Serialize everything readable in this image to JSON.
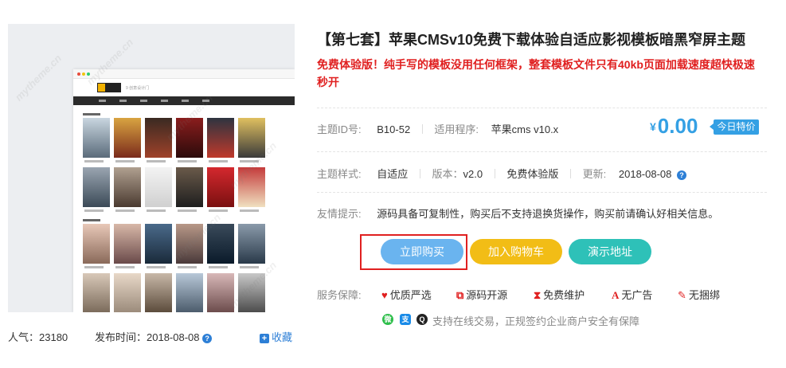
{
  "product": {
    "title": "【第七套】苹果CMSv10免费下载体验自适应影视模板暗黑窄屏主题",
    "description": "免费体验版！纯手写的模板没用任何框架，整套模板文件只有40kb页面加载速度超快极速秒开"
  },
  "preview": {
    "site_search_text": "9 创意设计门",
    "watermark_text": "mytheme.cn",
    "popularity_label": "人气：",
    "popularity_value": "23180",
    "publish_label": "发布时间：",
    "publish_date": "2018-08-08",
    "help_glyph": "?",
    "favorite_label": "收藏",
    "favorite_glyph": "+"
  },
  "info": {
    "theme_id_label": "主题ID号:",
    "theme_id_value": "B10-52",
    "program_label": "适用程序:",
    "program_value": "苹果cms v10.x",
    "style_label": "主题样式:",
    "style_value": "自适应",
    "version_label": "版本：",
    "version_value": "v2.0",
    "edition_value": "免费体验版",
    "update_label": "更新:",
    "update_value": "2018-08-08",
    "tip_label": "友情提示:",
    "tip_value": "源码具备可复制性，购买后不支持退换货操作，购买前请确认好相关信息。"
  },
  "price": {
    "currency": "¥",
    "amount": "0.00",
    "badge": "今日特价"
  },
  "buttons": {
    "buy": "立即购买",
    "cart": "加入购物车",
    "demo": "演示地址"
  },
  "service": {
    "label": "服务保障:",
    "items": [
      {
        "icon": "location-pin-icon",
        "glyph": "♥",
        "text": "优质严选"
      },
      {
        "icon": "copy-icon",
        "glyph": "⧉",
        "text": "源码开源"
      },
      {
        "icon": "hourglass-icon",
        "glyph": "⧗",
        "text": "免费维护"
      },
      {
        "icon": "font-icon",
        "glyph": "A",
        "text": "无广告"
      },
      {
        "icon": "wrench-icon",
        "glyph": "✎",
        "text": "无捆绑"
      }
    ]
  },
  "payment": {
    "wechat_glyph": "微",
    "alipay_glyph": "支",
    "qq_glyph": "Q",
    "text": "支持在线交易，正规签约企业商户安全有保障"
  },
  "colors": {
    "accent_blue": "#34a0e4",
    "highlight_red": "#e02020",
    "cart_yellow": "#f2bd16",
    "demo_teal": "#2ec1b8",
    "buy_blue": "#6ab4ef"
  }
}
